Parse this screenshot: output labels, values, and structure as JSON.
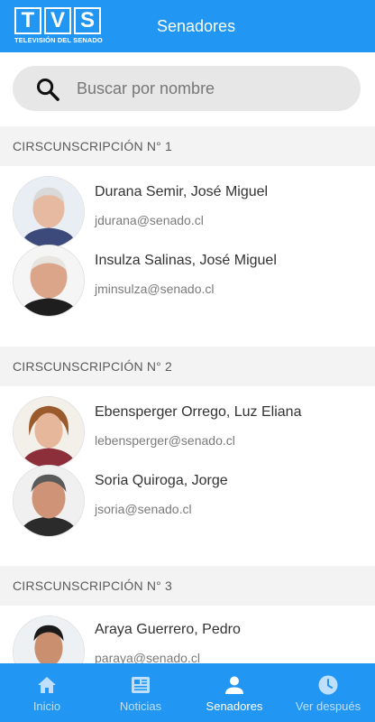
{
  "header": {
    "logo_letters": [
      "T",
      "V",
      "S"
    ],
    "logo_subtitle": "TELEVISIÓN DEL SENADO",
    "title": "Senadores"
  },
  "search": {
    "placeholder": "Buscar por nombre",
    "icon": "search-icon"
  },
  "sections": [
    {
      "title": "CIRSCUNSCRIPCIÓN N° 1",
      "senators": [
        {
          "name": "Durana Semir, José Miguel",
          "email": "jdurana@senado.cl"
        },
        {
          "name": "Insulza Salinas, José Miguel",
          "email": "jminsulza@senado.cl"
        }
      ]
    },
    {
      "title": "CIRSCUNSCRIPCIÓN N° 2",
      "senators": [
        {
          "name": "Ebensperger Orrego, Luz Eliana",
          "email": "lebensperger@senado.cl"
        },
        {
          "name": "Soria Quiroga, Jorge",
          "email": "jsoria@senado.cl"
        }
      ]
    },
    {
      "title": "CIRSCUNSCRIPCIÓN N° 3",
      "senators": [
        {
          "name": "Araya Guerrero, Pedro",
          "email": "paraya@senado.cl"
        }
      ]
    }
  ],
  "bottom_nav": [
    {
      "label": "Inicio",
      "icon": "home-icon",
      "active": false
    },
    {
      "label": "Noticias",
      "icon": "news-icon",
      "active": false
    },
    {
      "label": "Senadores",
      "icon": "person-icon",
      "active": true
    },
    {
      "label": "Ver después",
      "icon": "clock-icon",
      "active": false
    }
  ],
  "colors": {
    "primary": "#2196f3",
    "section_bg": "#f3f3f3",
    "search_bg": "#e7e7e7"
  }
}
